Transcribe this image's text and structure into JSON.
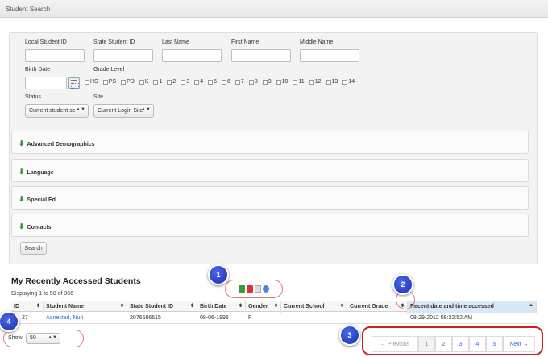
{
  "header": {
    "title": "Student Search"
  },
  "form": {
    "local_id_label": "Local Student ID",
    "state_id_label": "State Student ID",
    "last_name_label": "Last Name",
    "first_name_label": "First Name",
    "middle_name_label": "Middle Name",
    "birth_date_label": "Birth Date",
    "grade_level_label": "Grade Level",
    "grades": [
      "HS",
      "PS",
      "PD",
      "K",
      "1",
      "2",
      "3",
      "4",
      "5",
      "6",
      "7",
      "8",
      "9",
      "10",
      "11",
      "12",
      "13",
      "14"
    ],
    "status_label": "Status",
    "status_value": "Current student se",
    "site_label": "Site",
    "site_value": "Current Login Site"
  },
  "sections": [
    "Advanced Demographics",
    "Language",
    "Special Ed",
    "Contacts"
  ],
  "search_button": "Search",
  "recent": {
    "title": "My Recently Accessed Students",
    "displaying": "Displaying 1 to 50 of 366"
  },
  "table": {
    "columns": [
      "ID",
      "Student Name",
      "State Student ID",
      "Birth Date",
      "Gender",
      "Current School",
      "Current Grade",
      "Recent date and time accessed"
    ],
    "rows": [
      [
        "27",
        "Aanestad, Nuri",
        "2076586615",
        "08-06-1996",
        "F",
        "",
        "",
        "08-29-2012 09:32:52 AM"
      ]
    ]
  },
  "show": {
    "label": "Show",
    "value": "50"
  },
  "pagination": {
    "prev": "← Previous",
    "pages": [
      "1",
      "2",
      "3",
      "4",
      "5"
    ],
    "next": "Next →"
  },
  "badges": [
    "1",
    "2",
    "3",
    "4"
  ],
  "icons": {
    "sort": "sort-arrows-icon",
    "calendar": "calendar-icon",
    "export": [
      "excel-icon",
      "pdf-icon",
      "csv-icon",
      "print-icon"
    ]
  }
}
